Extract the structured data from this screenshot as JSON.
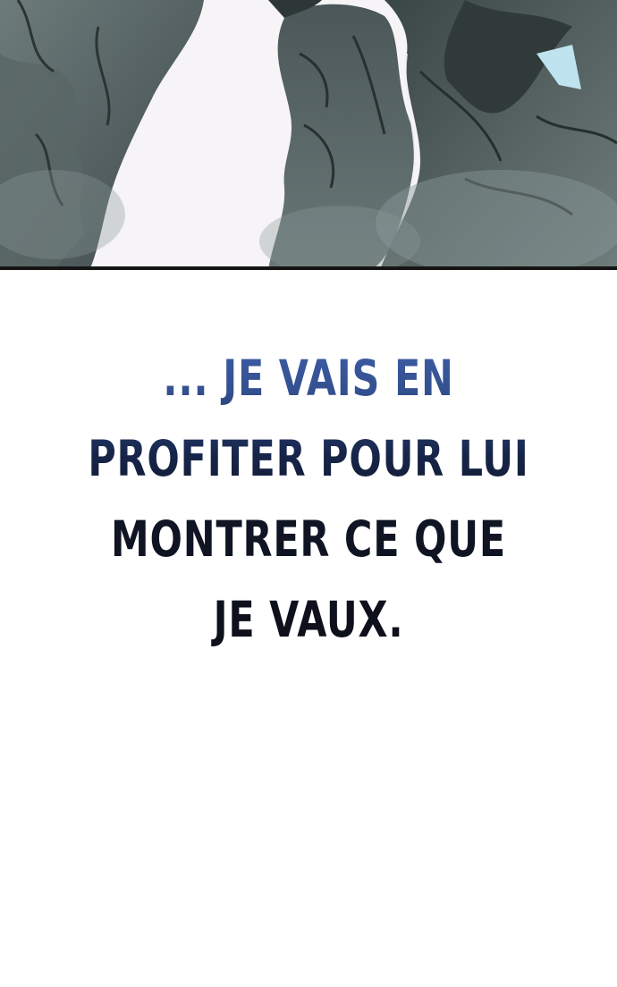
{
  "panel": {
    "scene": "smoky-figures-illustration",
    "colors": {
      "sky": "#f6f4f6",
      "smoke": "#5f6e6e",
      "shadow": "#2d3536",
      "border": "#151515",
      "accent_blue": "#bfe3ef"
    }
  },
  "caption": {
    "lines": [
      "... JE VAIS EN",
      "PROFITER POUR LUI",
      "MONTRER CE QUE",
      "JE VAUX."
    ],
    "colors": {
      "top": "#3f5ea9",
      "bottom": "#0d0f18"
    }
  }
}
